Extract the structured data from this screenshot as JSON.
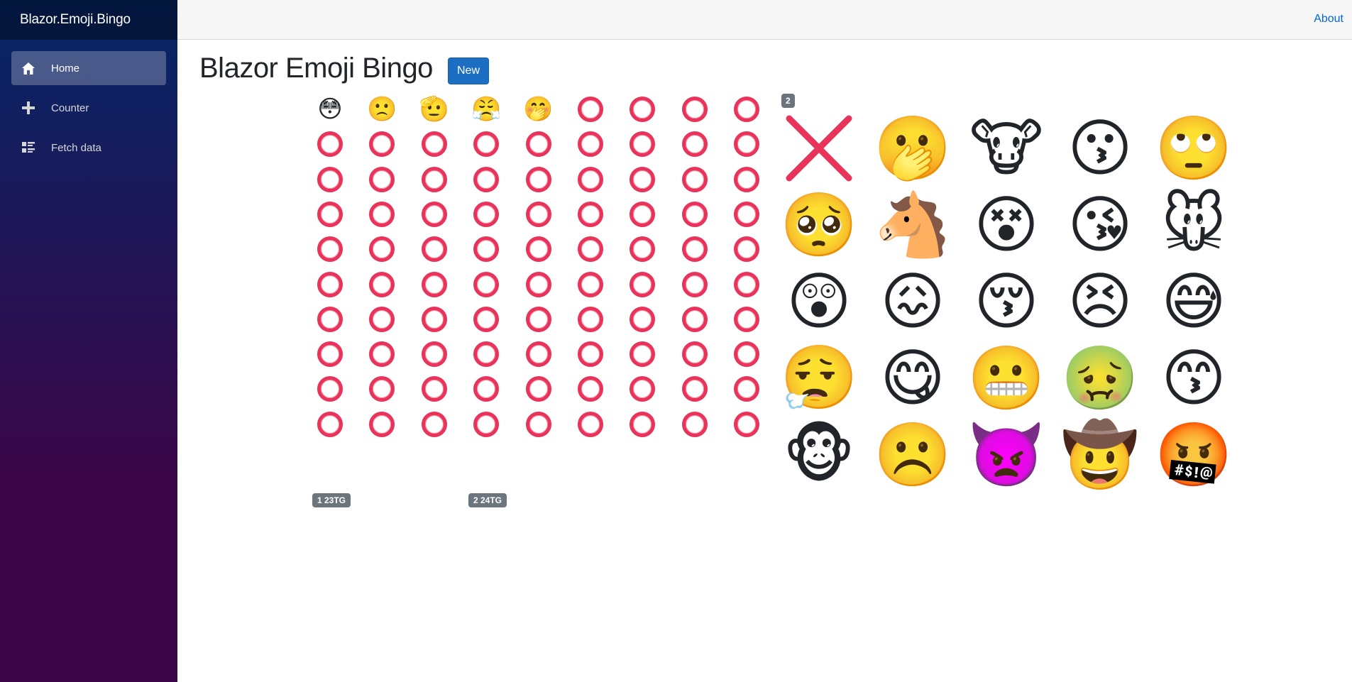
{
  "app": {
    "brand": "Blazor.Emoji.Bingo"
  },
  "nav": [
    {
      "label": "Home",
      "icon": "home-icon",
      "active": true
    },
    {
      "label": "Counter",
      "icon": "plus-icon",
      "active": false
    },
    {
      "label": "Fetch data",
      "icon": "list-rich-icon",
      "active": false
    }
  ],
  "topbar": {
    "about_label": "About"
  },
  "page": {
    "title": "Blazor Emoji Bingo",
    "new_button_label": "New"
  },
  "colors": {
    "ring": "#e8335a",
    "sidebar_top": "#052767",
    "sidebar_bottom": "#3a0647",
    "button": "#1b6ec2"
  },
  "board": {
    "rows": 10,
    "cols": 9,
    "filled_top_row": [
      {
        "emoji": "😳",
        "name": "flushed-face"
      },
      {
        "emoji": "🙁",
        "name": "slightly-frowning-face"
      },
      {
        "emoji": "🫡",
        "name": "saluting-face"
      },
      {
        "emoji": "😤",
        "name": "face-with-steam-from-nose"
      },
      {
        "emoji": "🤭",
        "name": "face-with-hand-over-mouth"
      }
    ]
  },
  "players": [
    {
      "label": "1 23TG"
    },
    {
      "label": "2 24TG"
    }
  ],
  "picks": {
    "badge": "2",
    "rows": [
      [
        {
          "emoji": "cross",
          "name": "cross-mark-icon"
        },
        {
          "emoji": "🫢",
          "name": "face-with-open-eyes-and-hand-over-mouth"
        },
        {
          "emoji": "🐮",
          "name": "cow-face"
        },
        {
          "emoji": "😗",
          "name": "kissing-face"
        },
        {
          "emoji": "🙄",
          "name": "face-with-rolling-eyes"
        }
      ],
      [
        {
          "emoji": "🥺",
          "name": "pleading-face"
        },
        {
          "emoji": "🐴",
          "name": "horse-face"
        },
        {
          "emoji": "😵",
          "name": "face-with-crossed-out-eyes"
        },
        {
          "emoji": "😘",
          "name": "face-blowing-a-kiss"
        },
        {
          "emoji": "🐭",
          "name": "mouse-face"
        }
      ],
      [
        {
          "emoji": "😲",
          "name": "astonished-face"
        },
        {
          "emoji": "😖",
          "name": "confounded-face"
        },
        {
          "emoji": "😚",
          "name": "kissing-face-with-closed-eyes"
        },
        {
          "emoji": "😣",
          "name": "persevering-face"
        },
        {
          "emoji": "😅",
          "name": "grinning-face-with-sweat"
        }
      ],
      [
        {
          "emoji": "😮‍💨",
          "name": "face-exhaling"
        },
        {
          "emoji": "😋",
          "name": "face-savoring-food"
        },
        {
          "emoji": "😬",
          "name": "grimacing-face"
        },
        {
          "emoji": "🤢",
          "name": "nauseated-face"
        },
        {
          "emoji": "😙",
          "name": "kissing-face-with-smiling-eyes"
        }
      ],
      [
        {
          "emoji": "🐵",
          "name": "monkey-face"
        },
        {
          "emoji": "☹️",
          "name": "frowning-face"
        },
        {
          "emoji": "👿",
          "name": "angry-face-with-horns"
        },
        {
          "emoji": "🤠",
          "name": "cowboy-hat-face"
        },
        {
          "emoji": "🤬",
          "name": "face-with-symbols-on-mouth"
        }
      ]
    ]
  }
}
